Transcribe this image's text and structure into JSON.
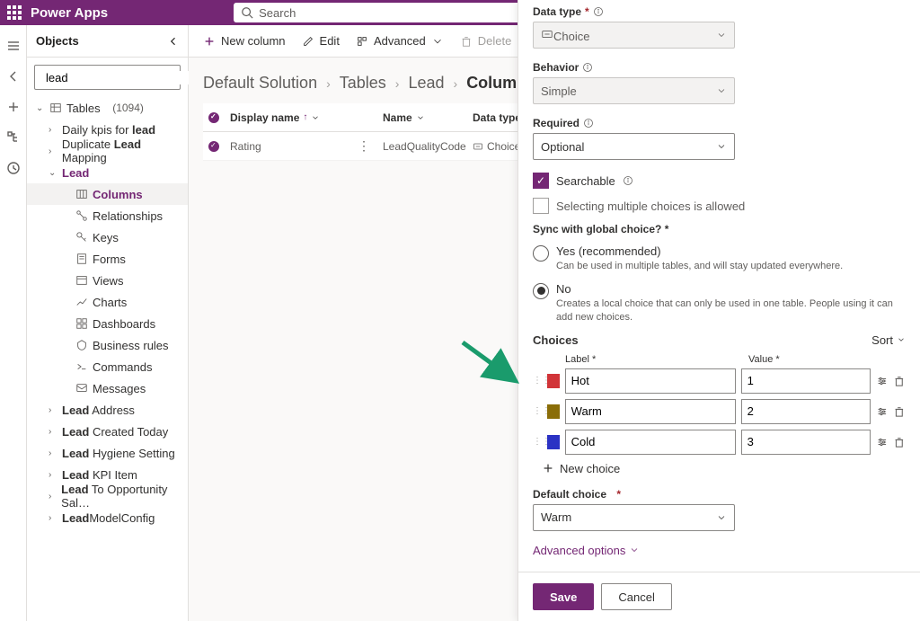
{
  "app": {
    "title": "Power Apps",
    "search_placeholder": "Search"
  },
  "objects": {
    "title": "Objects",
    "search_value": "lead",
    "tables_label": "Tables",
    "tables_count": "(1094)",
    "items": {
      "daily_kpis": "Daily kpis for ",
      "daily_kpis_bold": "lead",
      "duplicate": "Duplicate ",
      "duplicate_bold": "Lead",
      "duplicate_suffix": " Mapping",
      "lead": "Lead",
      "columns": "Columns",
      "relationships": "Relationships",
      "keys": "Keys",
      "forms": "Forms",
      "views": "Views",
      "charts": "Charts",
      "dashboards": "Dashboards",
      "business_rules": "Business rules",
      "commands": "Commands",
      "messages": "Messages",
      "lead_address_pre": "Lead",
      "lead_address_suf": " Address",
      "lead_created_pre": "Lead",
      "lead_created_suf": " Created Today",
      "lead_hygiene_pre": "Lead",
      "lead_hygiene_suf": " Hygiene Setting",
      "lead_kpi_pre": "Lead",
      "lead_kpi_suf": " KPI Item",
      "lead_opp_pre": "Lead",
      "lead_opp_suf": " To Opportunity Sal…",
      "lead_model_pre": "Lead",
      "lead_model_suf": "ModelConfig"
    }
  },
  "cmdbar": {
    "new": "New column",
    "edit": "Edit",
    "advanced": "Advanced",
    "delete": "Delete"
  },
  "breadcrumb": {
    "s1": "Default Solution",
    "s2": "Tables",
    "s3": "Lead",
    "s4": "Columns"
  },
  "grid": {
    "h1": "Display name",
    "h2": "Name",
    "h3": "Data type",
    "r1_display": "Rating",
    "r1_name": "LeadQualityCode",
    "r1_type": "Choice"
  },
  "panel": {
    "data_type_label": "Data type",
    "data_type_value": "Choice",
    "behavior_label": "Behavior",
    "behavior_value": "Simple",
    "required_label": "Required",
    "required_value": "Optional",
    "searchable": "Searchable",
    "multi_select": "Selecting multiple choices is allowed",
    "sync_label": "Sync with global choice? *",
    "radio_yes": "Yes (recommended)",
    "radio_yes_desc": "Can be used in multiple tables, and will stay updated everywhere.",
    "radio_no": "No",
    "radio_no_desc": "Creates a local choice that can only be used in one table. People using it can add new choices.",
    "choices_head": "Choices",
    "sort": "Sort",
    "col_label": "Label *",
    "col_value": "Value *",
    "choices": [
      {
        "label": "Hot",
        "value": "1",
        "color": "#d13438"
      },
      {
        "label": "Warm",
        "value": "2",
        "color": "#8a6d08"
      },
      {
        "label": "Cold",
        "value": "3",
        "color": "#2b32c4"
      }
    ],
    "new_choice": "New choice",
    "default_label": "Default choice",
    "default_value": "Warm",
    "advanced": "Advanced options",
    "save": "Save",
    "cancel": "Cancel"
  }
}
